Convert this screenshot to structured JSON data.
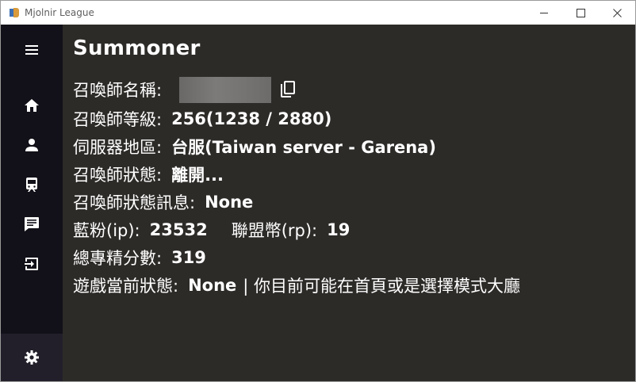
{
  "window": {
    "title": "Mjolnir League"
  },
  "sidebar": {
    "items": [
      {
        "name": "menu-icon"
      },
      {
        "name": "home-icon"
      },
      {
        "name": "person-icon"
      },
      {
        "name": "train-icon"
      },
      {
        "name": "chat-icon"
      },
      {
        "name": "exit-icon"
      },
      {
        "name": "gear-icon"
      }
    ]
  },
  "main": {
    "title": "Summoner",
    "rows": {
      "name_label": "召喚師名稱:",
      "level_label": "召喚師等級:",
      "level_value": "256(1238 / 2880)",
      "server_label": "伺服器地區:",
      "server_value": "台服(Taiwan server - Garena)",
      "status_label": "召喚師狀態:",
      "status_value": "離開...",
      "status_msg_label": "召喚師狀態訊息:",
      "status_msg_value": "None",
      "ip_label": "藍粉(ip):",
      "ip_value": "23532",
      "rp_label": "聯盟幣(rp):",
      "rp_value": "19",
      "mastery_label": "總專精分數:",
      "mastery_value": "319",
      "game_state_label": "遊戲當前狀態:",
      "game_state_value": "None",
      "game_state_note": "| 你目前可能在首頁或是選擇模式大廳"
    }
  },
  "colors": {
    "sidebar_bg": "#121018",
    "content_bg": "#2d2b28",
    "settings_bg": "#221f2a",
    "text": "#ffffff"
  }
}
